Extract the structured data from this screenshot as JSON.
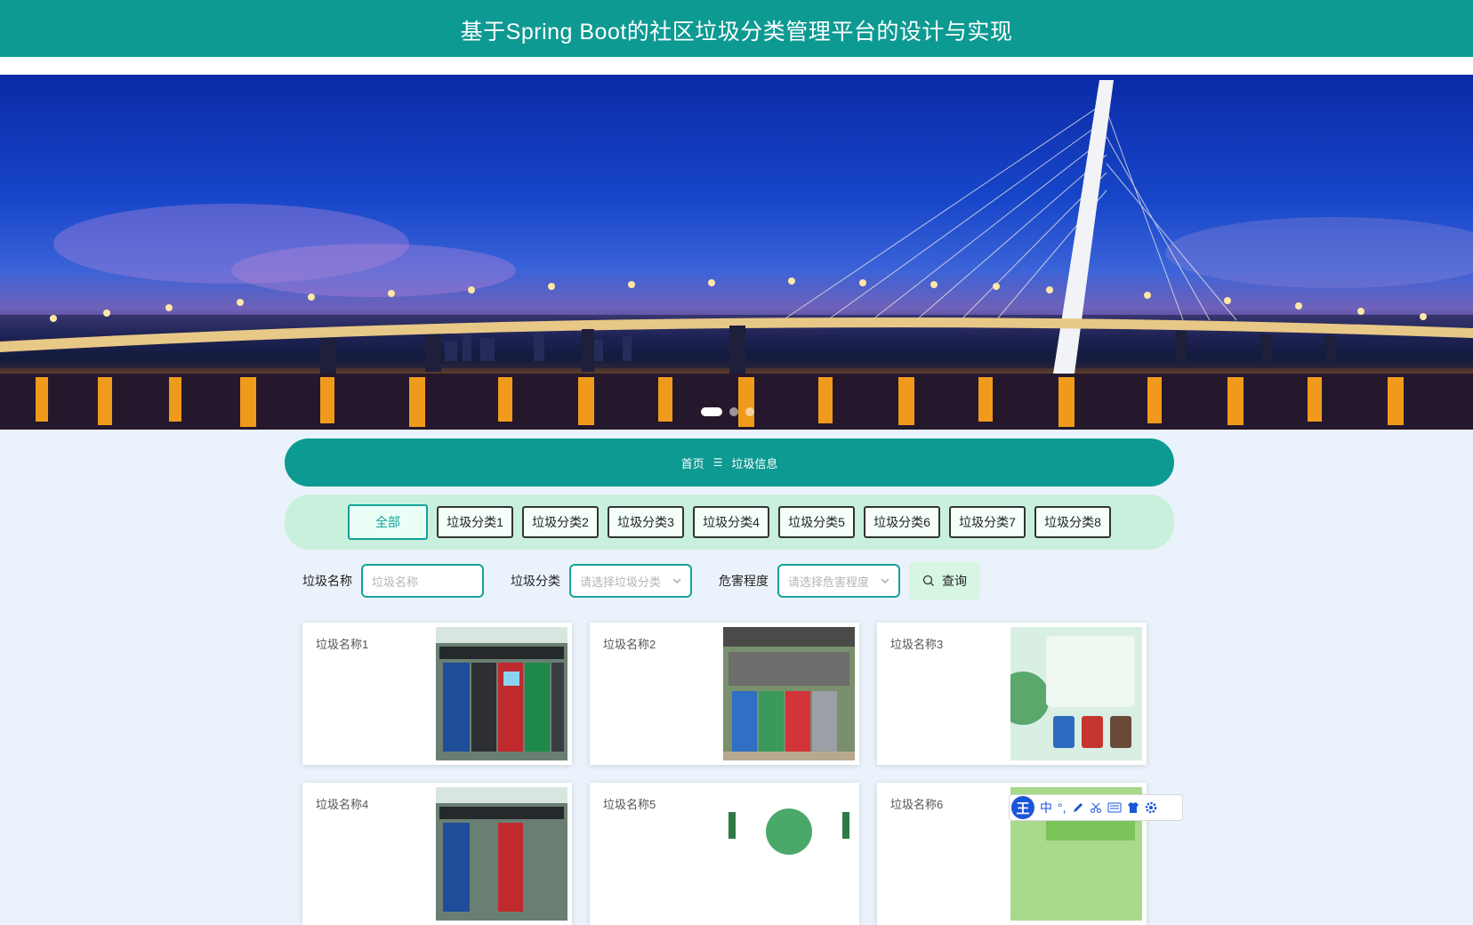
{
  "header": {
    "title": "基于Spring Boot的社区垃圾分类管理平台的设计与实现"
  },
  "banner": {
    "slides": 3,
    "active_slide": 1
  },
  "breadcrumb": {
    "home": "首页",
    "separator": "☰",
    "current": "垃圾信息"
  },
  "categories": {
    "items": [
      "全部",
      "垃圾分类1",
      "垃圾分类2",
      "垃圾分类3",
      "垃圾分类4",
      "垃圾分类5",
      "垃圾分类6",
      "垃圾分类7",
      "垃圾分类8"
    ],
    "active": "全部"
  },
  "filters": {
    "name_label": "垃圾名称",
    "name_placeholder": "垃圾名称",
    "category_label": "垃圾分类",
    "category_placeholder": "请选择垃圾分类",
    "hazard_label": "危害程度",
    "hazard_placeholder": "请选择危害程度",
    "query_button": "查询"
  },
  "items": [
    {
      "name": "垃圾名称1",
      "thumb": "sorting-station"
    },
    {
      "name": "垃圾名称2",
      "thumb": "bin-shelter"
    },
    {
      "name": "垃圾名称3",
      "thumb": "sorting-illustration"
    },
    {
      "name": "垃圾名称4",
      "thumb": "sorting-station"
    },
    {
      "name": "垃圾名称5",
      "thumb": "eco-poster"
    },
    {
      "name": "垃圾名称6",
      "thumb": "green-poster"
    }
  ],
  "ime_toolbar": {
    "logo": "王",
    "mode": "中",
    "punct": "°,"
  },
  "colors": {
    "primary": "#0d9a92",
    "accent_light": "#c9f0dc",
    "background": "#eaf3fb"
  }
}
